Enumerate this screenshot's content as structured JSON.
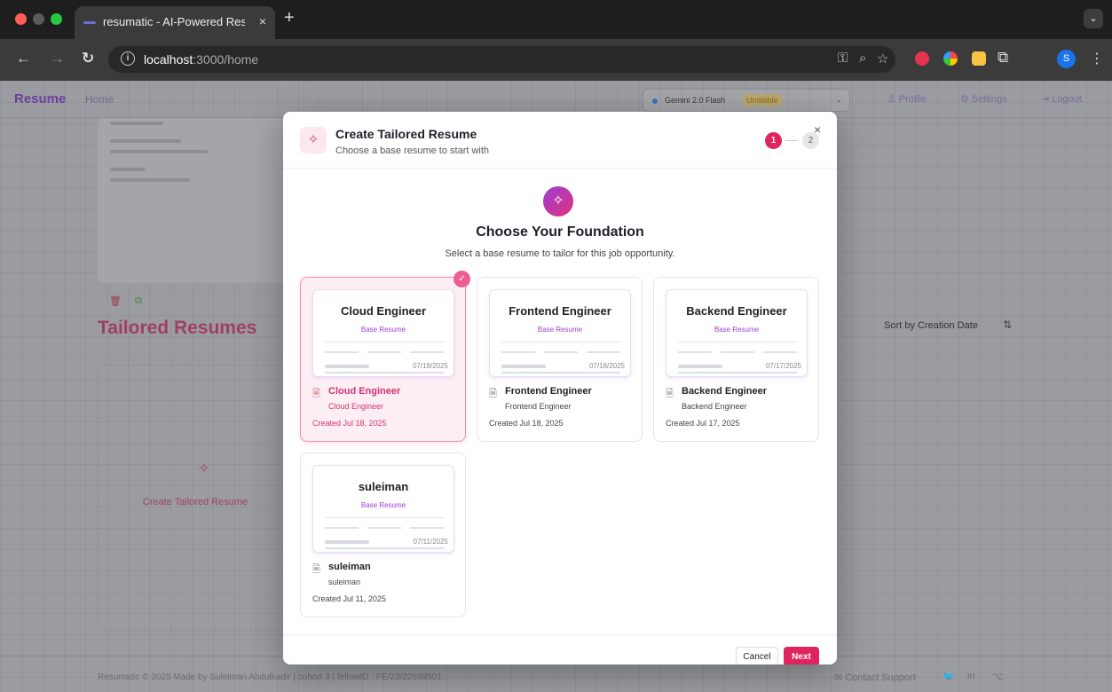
{
  "browser": {
    "tab_title": "resumatic - AI-Powered Resu",
    "tab_close": "×",
    "new_tab": "+",
    "url_host": "localhost",
    "url_rest": ":3000/home",
    "profile_initial": "S"
  },
  "app": {
    "brand": "Resume",
    "home_link": "Home",
    "model_name": "Gemini 2.0 Flash",
    "model_badge": "Unstable",
    "nav_profile": "Profile",
    "nav_settings": "Settings",
    "nav_logout": "Logout",
    "tailored_title": "Tailored Resumes",
    "sort_label": "Sort by Creation Date",
    "create_tailored": "Create Tailored Resume",
    "footer_text": "Resumatic © 2025   Made by Suleiman Abdulkadir | cohort 3 | fellowID : FE/23/22599501",
    "footer_support": "Contact Support"
  },
  "modal": {
    "title": "Create Tailored Resume",
    "subtitle": "Choose a base resume to start with",
    "step1": "1",
    "step2": "2",
    "close": "×",
    "heading": "Choose Your Foundation",
    "description": "Select a base resume to tailor for this job opportunity.",
    "cards": [
      {
        "preview_title": "Cloud Engineer",
        "tag": "Base Resume",
        "preview_date": "07/18/2025",
        "name": "Cloud Engineer",
        "role": "Cloud Engineer",
        "created": "Created Jul 18, 2025",
        "selected": true
      },
      {
        "preview_title": "Frontend Engineer",
        "tag": "Base Resume",
        "preview_date": "07/18/2025",
        "name": "Frontend Engineer",
        "role": "Frontend Engineer",
        "created": "Created Jul 18, 2025",
        "selected": false
      },
      {
        "preview_title": "Backend Engineer",
        "tag": "Base Resume",
        "preview_date": "07/17/2025",
        "name": "Backend Engineer",
        "role": "Backend Engineer",
        "created": "Created Jul 17, 2025",
        "selected": false
      },
      {
        "preview_title": "suleiman",
        "tag": "Base Resume",
        "preview_date": "07/11/2025",
        "name": "suleiman",
        "role": "suleiman",
        "created": "Created Jul 11, 2025",
        "selected": false
      }
    ],
    "cancel_label": "Cancel",
    "next_label": "Next"
  },
  "colors": {
    "accent": "#e0245e",
    "brand_purple": "#a43ad3"
  }
}
